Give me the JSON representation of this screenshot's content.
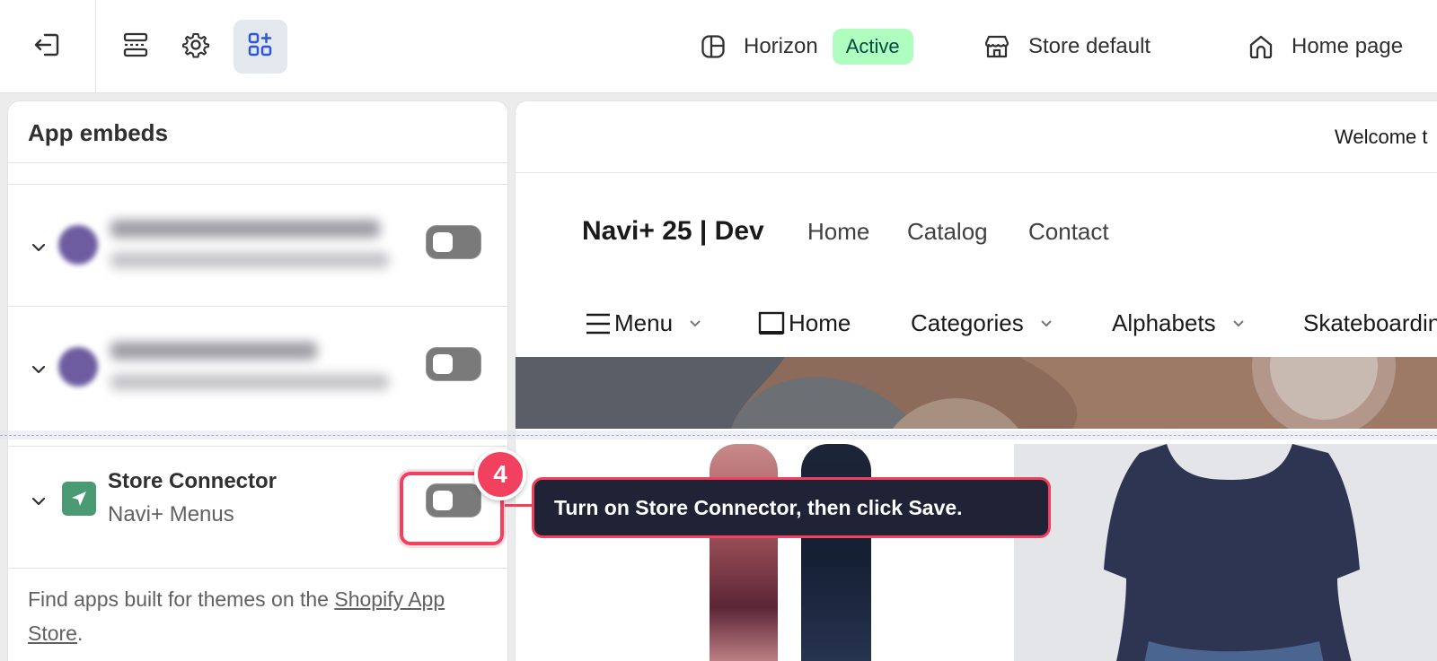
{
  "toolbar": {
    "exit_icon": "exit-icon",
    "sections_icon": "sections-icon",
    "settings_icon": "gear-icon",
    "app_embeds_icon": "apps-icon",
    "theme_name": "Horizon",
    "theme_status": "Active",
    "store_label": "Store default",
    "page_label": "Home page"
  },
  "panel": {
    "title": "App embeds",
    "embeds": [
      {
        "name": "[blurred]",
        "sub": "[blurred]",
        "enabled": false
      },
      {
        "name": "[blurred]",
        "sub": "[blurred]",
        "enabled": false
      },
      {
        "name": "Store Connector",
        "sub": "Navi+ Menus",
        "enabled": false
      }
    ],
    "footer_prefix": "Find apps built for themes on the ",
    "footer_link": "Shopify App Store",
    "footer_suffix": "."
  },
  "preview": {
    "announcement": "Welcome t",
    "brand": "Navi+ 25 | Dev",
    "header_nav": [
      "Home",
      "Catalog",
      "Contact"
    ],
    "menu": [
      "Menu",
      "Home",
      "Categories",
      "Alphabets",
      "Skateboardin"
    ]
  },
  "callout": {
    "step": "4",
    "text": "Turn on Store Connector, then click Save."
  },
  "colors": {
    "accent": "#f2405f",
    "tooltip_bg": "#1f2335",
    "badge_bg": "#affebf",
    "app_icon": "#4a9a73"
  }
}
